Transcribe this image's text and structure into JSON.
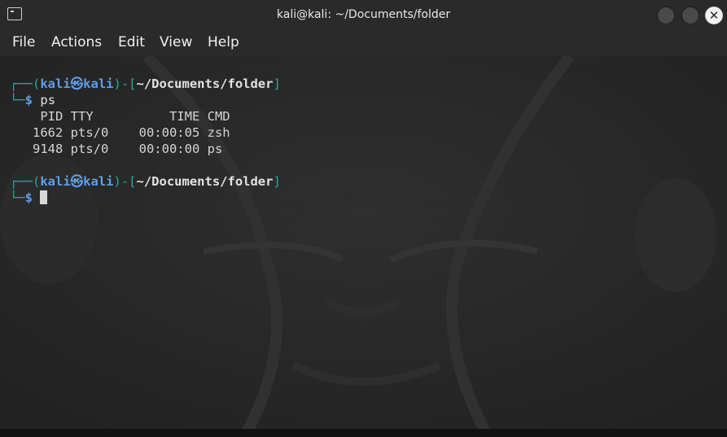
{
  "window": {
    "title": "kali@kali: ~/Documents/folder",
    "icon": "terminal-icon",
    "close_glyph": "✕"
  },
  "menu": {
    "file": "File",
    "actions": "Actions",
    "edit": "Edit",
    "view": "View",
    "help": "Help"
  },
  "terminal": {
    "prompt1": {
      "frame_top_left": "┌──(",
      "user": "kali",
      "at_symbol": "㉿",
      "host": "kali",
      "frame_mid": ")-[",
      "path": "~/Documents/folder",
      "frame_end": "]",
      "frame_bottom": "└─",
      "dollar": "$",
      "command": "ps"
    },
    "ps_output": {
      "header": "    PID TTY          TIME CMD",
      "rows": [
        "   1662 pts/0    00:00:05 zsh",
        "   9148 pts/0    00:00:00 ps"
      ]
    },
    "prompt2": {
      "frame_top_left": "┌──(",
      "user": "kali",
      "at_symbol": "㉿",
      "host": "kali",
      "frame_mid": ")-[",
      "path": "~/Documents/folder",
      "frame_end": "]",
      "frame_bottom": "└─",
      "dollar": "$",
      "command": ""
    }
  },
  "colors": {
    "frame": "#27a8a0",
    "user": "#5f9fe6",
    "background": "#272727"
  }
}
